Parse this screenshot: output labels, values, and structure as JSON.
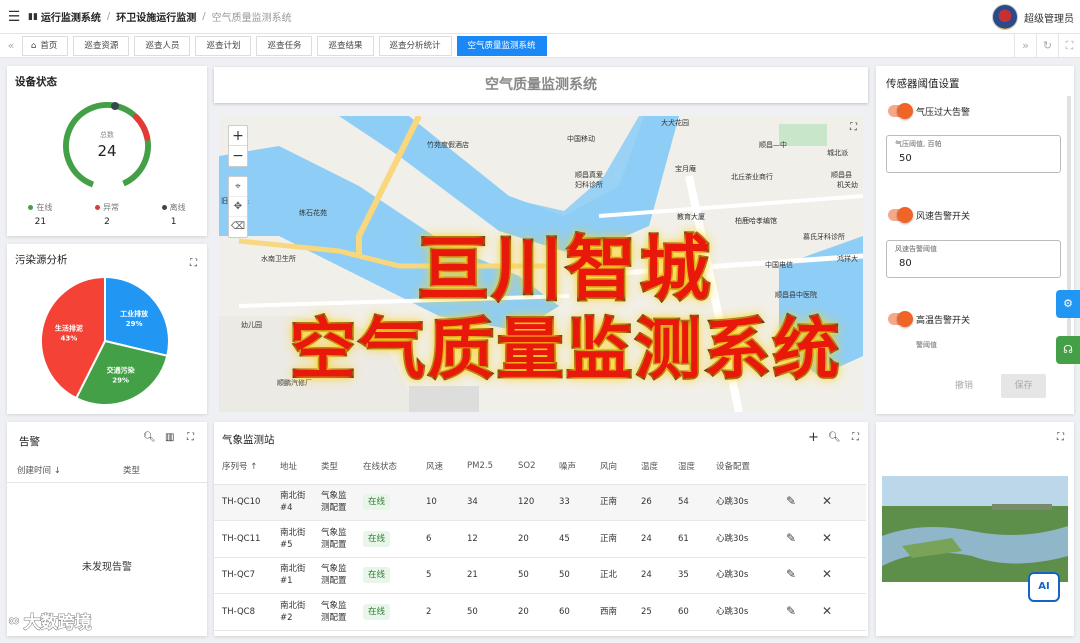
{
  "header": {
    "breadcrumb": [
      "运行监测系统",
      "环卫设施运行监测",
      "空气质量监测系统"
    ],
    "user_name": "超级管理员"
  },
  "tabs": [
    {
      "label": "首页"
    },
    {
      "label": "巡查资源"
    },
    {
      "label": "巡查人员"
    },
    {
      "label": "巡查计划"
    },
    {
      "label": "巡查任务"
    },
    {
      "label": "巡查结果"
    },
    {
      "label": "巡查分析统计"
    },
    {
      "label": "空气质量监测系统",
      "active": true
    }
  ],
  "device_status": {
    "title": "设备状态",
    "total_label": "总数",
    "total": "24",
    "online_label": "在线",
    "online": "21",
    "abnormal_label": "异常",
    "abnormal": "2",
    "offline_label": "离线",
    "offline": "1",
    "colors": {
      "online": "#43a047",
      "abnormal": "#e53935",
      "offline": "#37474f"
    }
  },
  "pollution": {
    "title": "污染源分析",
    "chart_data": {
      "type": "pie",
      "labels": [
        "工业排放",
        "交通污染",
        "生活排泥"
      ],
      "values": [
        29,
        29,
        43
      ],
      "value_labels": [
        "29%",
        "29%",
        "43%"
      ],
      "colors": [
        "#2196f3",
        "#43a047",
        "#f44336"
      ]
    }
  },
  "map": {
    "title": "空气质量监测系统",
    "labels": [
      "大犬花园",
      "中国移动",
      "竹苑度假酒店",
      "顺昌—中",
      "城北派",
      "宝月庵",
      "北丘茶业商行",
      "顺昌县",
      "机关幼",
      "顺昌真爱",
      "妇科诊所",
      "练石花苑",
      "教育大厦",
      "柏鹿哈孝编馆",
      "慕氏牙科诊所",
      "水南卫生所",
      "中国电信",
      "鸿祥大",
      "顺昌县中医院",
      "幼儿园",
      "顺鹏汽修厂",
      "旧江家乐"
    ]
  },
  "sensor": {
    "title": "传感器阈值设置",
    "items": [
      {
        "toggle": "气压过大告警",
        "field_label": "气压阈值, 百帕",
        "value": "50"
      },
      {
        "toggle": "风速告警开关",
        "field_label": "风速告警阈值",
        "value": "80"
      },
      {
        "toggle": "高温告警开关",
        "field_label": "警阈值",
        "value": ""
      }
    ],
    "cancel": "撤销",
    "save": "保存"
  },
  "alarm": {
    "title": "告警",
    "col_time": "创建时间",
    "col_type": "类型",
    "empty": "未发现告警"
  },
  "stations": {
    "title": "气象监测站",
    "columns": [
      "序列号",
      "地址",
      "类型",
      "在线状态",
      "风速",
      "PM2.5",
      "SO2",
      "噪声",
      "风向",
      "温度",
      "湿度",
      "设备配置"
    ],
    "rows": [
      {
        "id": "TH-QC10",
        "addr": "南北街 #4",
        "type": "气象监 测配置",
        "status": "在线",
        "wind": "10",
        "pm": "34",
        "so2": "120",
        "noise": "33",
        "dir": "正南",
        "temp": "26",
        "hum": "54",
        "cfg": "心跳30s"
      },
      {
        "id": "TH-QC11",
        "addr": "南北街 #5",
        "type": "气象监 测配置",
        "status": "在线",
        "wind": "6",
        "pm": "12",
        "so2": "20",
        "noise": "45",
        "dir": "正南",
        "temp": "24",
        "hum": "61",
        "cfg": "心跳30s"
      },
      {
        "id": "TH-QC7",
        "addr": "南北街 #1",
        "type": "气象监 测配置",
        "status": "在线",
        "wind": "5",
        "pm": "21",
        "so2": "50",
        "noise": "50",
        "dir": "正北",
        "temp": "24",
        "hum": "35",
        "cfg": "心跳30s"
      },
      {
        "id": "TH-QC8",
        "addr": "南北街 #2",
        "type": "气象监 测配置",
        "status": "在线",
        "wind": "2",
        "pm": "50",
        "so2": "20",
        "noise": "60",
        "dir": "西南",
        "temp": "25",
        "hum": "60",
        "cfg": "心跳30s"
      }
    ]
  },
  "overlay": {
    "line1": "亘川智城",
    "line2": "空气质量监测系统"
  },
  "watermark": "大数跨境",
  "ai_label": "AI"
}
